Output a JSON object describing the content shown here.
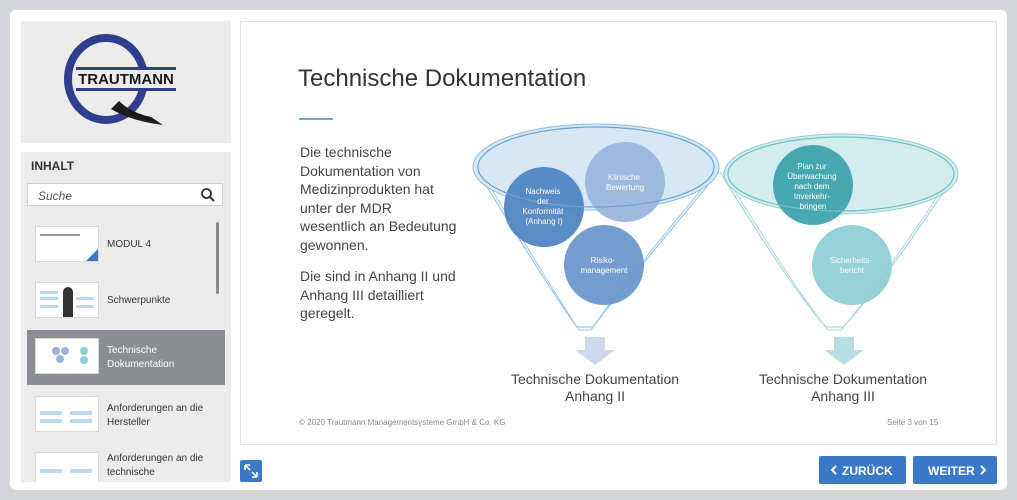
{
  "logo": {
    "text": "TRAUTMANN"
  },
  "toc": {
    "title": "INHALT",
    "search_placeholder": "Suche",
    "items": [
      {
        "label": "MODUL 4",
        "thumb_title": "Technische Dokumentation"
      },
      {
        "label": "Schwerpunkte",
        "thumb_title": "Schwerpunkte"
      },
      {
        "label": "Technische Dokumentation",
        "thumb_title": "Technische Dokumentation",
        "active": true
      },
      {
        "label": "Anforderungen an die Hersteller",
        "thumb_title": "Anforderungen an die Hersteller"
      },
      {
        "label": "Anforderungen an die technische",
        "thumb_title": "Anforderungen an die technische"
      }
    ]
  },
  "slide": {
    "title": "Technische Dokumentation",
    "paragraph1": "Die technische Dokumentation von Medizinprodukten hat unter der MDR wesentlich an Bedeutung gewonnen.",
    "paragraph2": "Die sind in Anhang II und Anhang III detailliert geregelt.",
    "funnel1": {
      "circles": [
        "Nachweis der Konformität (Anhang I)",
        "Klinische Bewertung",
        "Risiko-management"
      ],
      "caption_line1": "Technische Dokumentation",
      "caption_line2": "Anhang II"
    },
    "funnel2": {
      "circles": [
        "Plan zur Überwachung nach dem Inverkehr-bringen",
        "Sicherheits-bericht"
      ],
      "caption_line1": "Technische Dokumentation",
      "caption_line2": "Anhang III"
    },
    "footer_copyright": "© 2020 Trautmann Managementsysteme GmbH & Co. KG",
    "footer_page": "Seite 3 von 15"
  },
  "nav": {
    "back_label": "ZURÜCK",
    "next_label": "WEITER"
  },
  "colors": {
    "accent": "#3a78c8",
    "blue_dark": "#4f86c0",
    "blue_light": "#9bb6dc",
    "teal_dark": "#3fa3ad",
    "teal_light": "#8fcfd4"
  }
}
